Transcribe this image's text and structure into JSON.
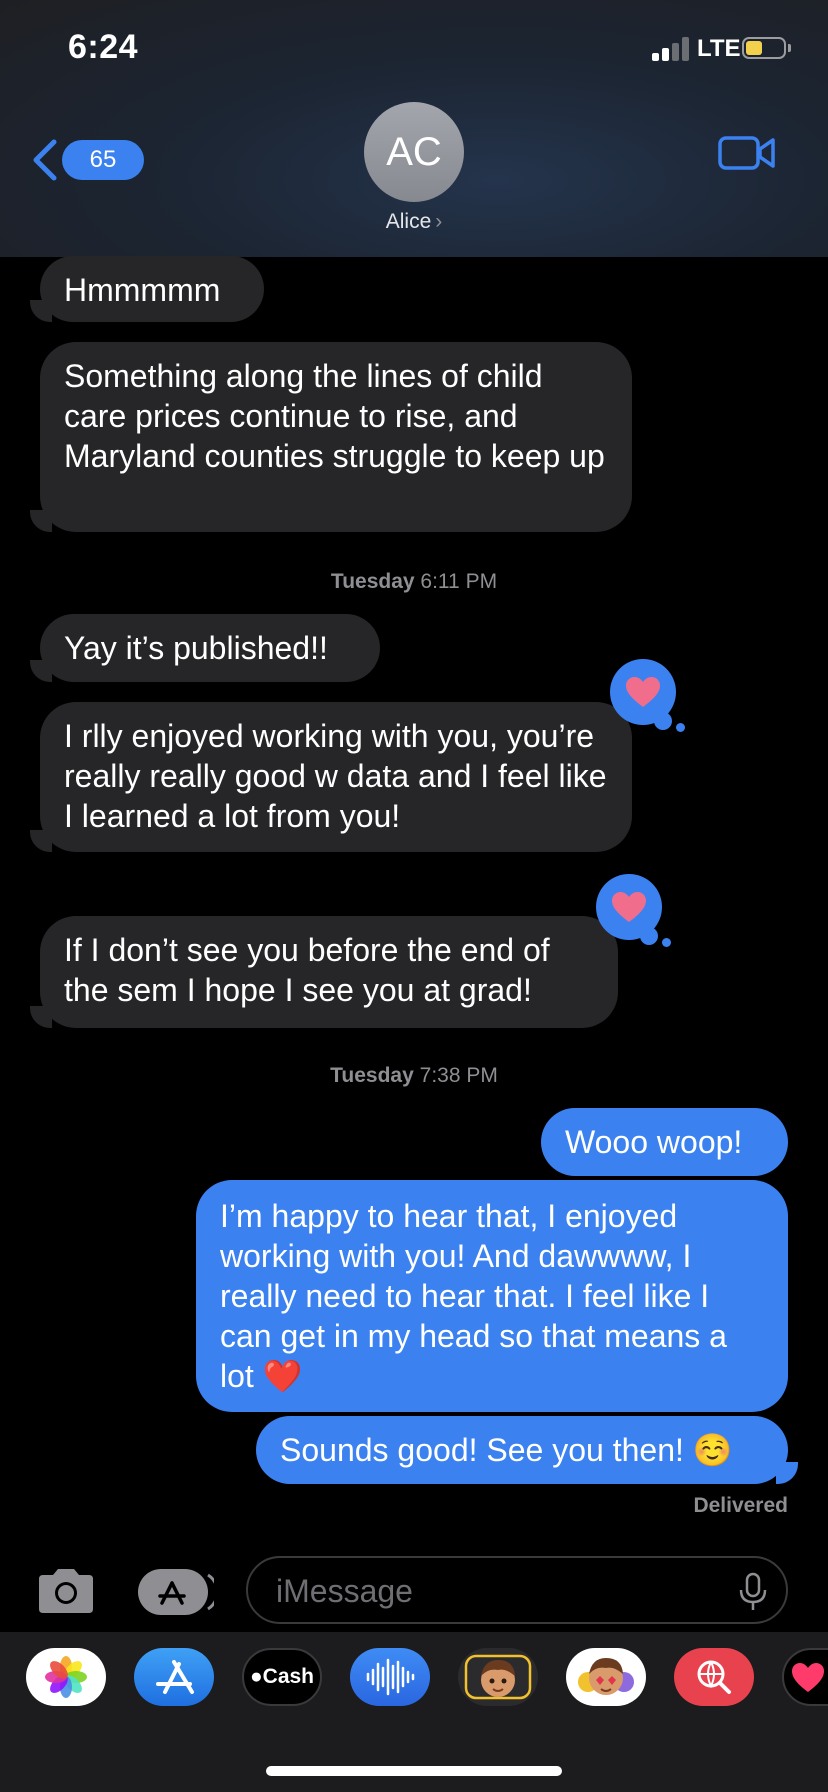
{
  "status_bar": {
    "time": "6:24",
    "network": "LTE"
  },
  "header": {
    "unread_count": "65",
    "avatar_initials": "AC",
    "contact_name": "Alice",
    "name_chevron": "›"
  },
  "messages": [
    {
      "text": "Hmmmmm"
    },
    {
      "text": "Something along the lines of child care prices continue to rise, and Maryland counties struggle to keep up"
    },
    {
      "day": "Tuesday",
      "time": "6:11 PM"
    },
    {
      "text": "Yay it’s published!!"
    },
    {
      "text": "I rlly enjoyed working with you, you’re really really good w data and I feel like I learned a lot from you!",
      "reaction": "heart"
    },
    {
      "text": "If I don’t see you before the end of the sem I hope I see you at grad!",
      "reaction": "heart"
    },
    {
      "day": "Tuesday",
      "time": "7:38 PM"
    },
    {
      "text": "Wooo woop!"
    },
    {
      "text": "I’m happy to hear that, I enjoyed working with you! And dawwww, I really need to hear that. I feel like I can get in my head so that means a lot ❤️"
    },
    {
      "text": "Sounds good! See you then! ☺️"
    }
  ],
  "delivery_status": "Delivered",
  "input": {
    "placeholder": "iMessage"
  },
  "apps": [
    {
      "name": "photos-app-icon"
    },
    {
      "name": "app-store-app-icon"
    },
    {
      "name": "apple-cash-app-icon",
      "label": "Cash"
    },
    {
      "name": "audio-message-app-icon"
    },
    {
      "name": "memoji-app-icon"
    },
    {
      "name": "animoji-stickers-app-icon"
    },
    {
      "name": "web-search-app-icon"
    },
    {
      "name": "digital-touch-app-icon"
    }
  ],
  "colors": {
    "accent": "#3b82f0",
    "incoming_bubble": "#262628",
    "reaction_heart": "#f06e8c",
    "background": "#000000"
  }
}
